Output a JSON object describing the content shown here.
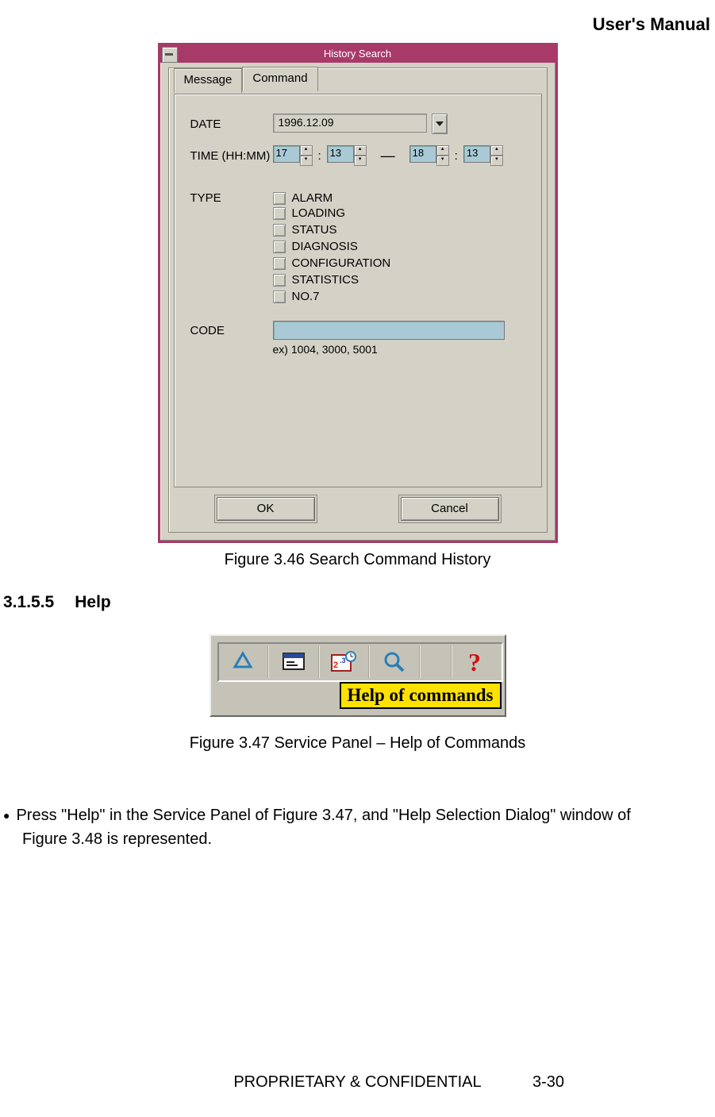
{
  "doc": {
    "header": "User's Manual",
    "footer_text": "PROPRIETARY & CONFIDENTIAL",
    "page_number": "3-30"
  },
  "fig1": {
    "window_title": "History Search",
    "tabs": {
      "message": "Message",
      "command": "Command"
    },
    "labels": {
      "date": "DATE",
      "time": "TIME (HH:MM)",
      "type": "TYPE",
      "code": "CODE"
    },
    "date_value": "1996.12.09",
    "time": {
      "from_h": "17",
      "from_m": "13",
      "to_h": "18",
      "to_m": "13"
    },
    "types": [
      "ALARM",
      "LOADING",
      "STATUS",
      "DIAGNOSIS",
      "CONFIGURATION",
      "STATISTICS",
      "NO.7"
    ],
    "code_example": "ex) 1004, 3000, 5001",
    "buttons": {
      "ok": "OK",
      "cancel": "Cancel"
    },
    "caption": "Figure 3.46 Search Command History"
  },
  "section": {
    "number": "3.1.5.5",
    "title": "Help"
  },
  "fig2": {
    "tooltip": "Help of commands",
    "caption": "Figure 3.47 Service Panel – Help of Commands",
    "icons": {
      "recycle": "recycle-icon",
      "window": "window-icon",
      "calendar": "calendar-icon",
      "search": "search-icon",
      "help": "help-icon"
    }
  },
  "body_text": {
    "bullet1_a": "Press \"Help\" in the Service Panel of Figure 3.47, and \"Help Selection Dialog\" window of",
    "bullet1_b": "Figure 3.48 is represented."
  }
}
